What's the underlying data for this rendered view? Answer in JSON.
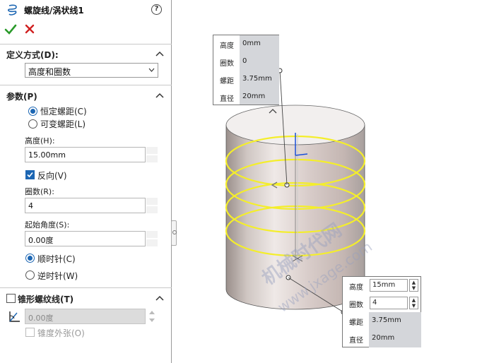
{
  "feature": {
    "title": "螺旋线/涡状线1",
    "help": "?",
    "ok_icon": "check-icon",
    "cancel_icon": "close-icon"
  },
  "definition": {
    "title": "定义方式(D):",
    "selected": "高度和圈数"
  },
  "parameters": {
    "title": "参数(P)",
    "pitch_mode": [
      {
        "label": "恒定螺距(C)",
        "checked": true
      },
      {
        "label": "可变螺距(L)",
        "checked": false
      }
    ],
    "height_label": "高度(H):",
    "height_value": "15.00mm",
    "reverse_label": "反向(V)",
    "reverse_checked": true,
    "revolutions_label": "圈数(R):",
    "revolutions_value": "4",
    "start_angle_label": "起始角度(S):",
    "start_angle_value": "0.00度",
    "direction": [
      {
        "label": "顺时针(C)",
        "checked": true
      },
      {
        "label": "逆时针(W)",
        "checked": false
      }
    ]
  },
  "taper": {
    "title": "锥形螺纹线(T)",
    "checked": false,
    "angle_value": "0.00度",
    "outward_label": "锥度外张(O)"
  },
  "callout_top": {
    "rows": [
      {
        "key": "高度",
        "value": "0mm"
      },
      {
        "key": "圈数",
        "value": "0"
      },
      {
        "key": "螺距",
        "value": "3.75mm"
      },
      {
        "key": "直径",
        "value": "20mm"
      }
    ]
  },
  "callout_bottom": {
    "rows": [
      {
        "key": "高度",
        "value": "15mm"
      },
      {
        "key": "圈数",
        "value": "4"
      },
      {
        "key": "螺距",
        "value": "3.75mm"
      },
      {
        "key": "直径",
        "value": "20mm"
      }
    ]
  },
  "watermark": {
    "line1": "机械时代网",
    "line2": "www.jxage.com"
  },
  "colors": {
    "accent": "#1c66b3",
    "helix": "#f4ee2a",
    "cylinder": "#c8beba",
    "ok": "#2a9a2a",
    "cancel": "#d02020"
  }
}
